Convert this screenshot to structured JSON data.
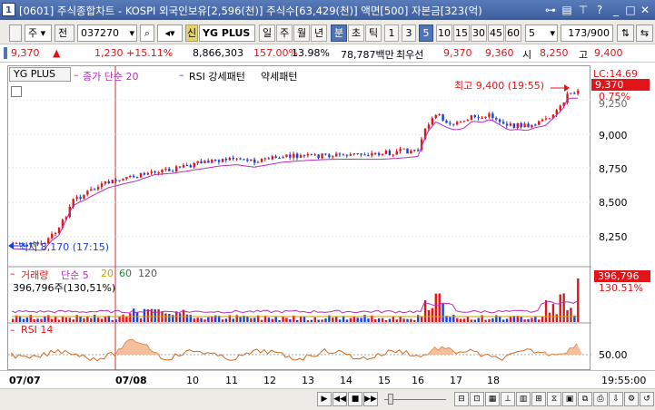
{
  "window": {
    "number": "1",
    "title": "[0601] 주식종합차트 - KOSPI 외국인보유[2,596(천)] 주식수[63,429(천)] 액면[500] 자본금[323(억)"
  },
  "toolbar": {
    "market": "주",
    "type": "전",
    "code": "037270",
    "stock": "YG PLUS",
    "shin": "신",
    "periods": [
      "일",
      "주",
      "월",
      "년",
      "분",
      "초",
      "틱"
    ],
    "minutes": [
      "1",
      "3",
      "5",
      "10",
      "15",
      "30",
      "45",
      "60"
    ],
    "interval": "5",
    "count": "173/900",
    "selected_period": "분",
    "selected_minute": "5"
  },
  "info": {
    "price": "9,370",
    "change": "1,230",
    "change_pct": "+15.11%",
    "volume": "8,866,303",
    "vol_ratio": "157.00%",
    "turnover": "13.98%",
    "amount": "78,787백만",
    "pref_label": "최우선",
    "bid": "9,370",
    "ask": "9,360",
    "open_label": "시",
    "open": "8,250",
    "high_label": "고",
    "high": "9,400"
  },
  "legend": {
    "stock": "YG PLUS",
    "ma": "종가 단순 20",
    "rsi_pattern": "RSI 강세패턴",
    "weak": "약세패턴",
    "high_note": "최고 9,400 (19:55)",
    "low_note": "최저 8,170 (17:15)",
    "volume": "거래량",
    "vol_ma": "단순 5",
    "ma20": "20",
    "ma60": "60",
    "ma120": "120",
    "vol_value": "396,796주(130,51%)",
    "rsi": "RSI 14"
  },
  "right_axis": {
    "lc": "LC:14.69",
    "price": "9,370",
    "pct": "0.75%",
    "ticks": [
      "9,250",
      "9,000",
      "8,750",
      "8,500",
      "8,250"
    ],
    "vol": "396,796",
    "vol_pct": "130.51%",
    "rsi_tick": "50.00"
  },
  "x_axis": {
    "labels": [
      "07/07",
      "07/08",
      "10",
      "11",
      "12",
      "13",
      "14",
      "15",
      "16",
      "17",
      "18"
    ],
    "time": "19:55:00"
  },
  "colors": {
    "up": "#e1141a",
    "down": "#1a3fd6",
    "ma": "#b52fb7",
    "accent": "#4e73b6",
    "rsi_fill": "#f2b48c"
  }
}
